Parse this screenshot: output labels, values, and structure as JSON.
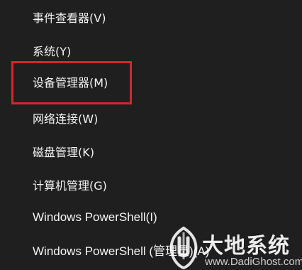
{
  "menu": {
    "items": [
      {
        "label": "事件查看器(V)"
      },
      {
        "label": "系统(Y)"
      },
      {
        "label": "设备管理器(M)"
      },
      {
        "label": "网络连接(W)"
      },
      {
        "label": "磁盘管理(K)"
      },
      {
        "label": "计算机管理(G)"
      },
      {
        "label": "Windows PowerShell(I)"
      },
      {
        "label": "Windows PowerShell (管理员)(A)"
      }
    ]
  },
  "watermark": {
    "title": "大地系统",
    "subtitle": "www.DadiGhost.com"
  },
  "colors": {
    "background": "#1f1f1f",
    "text": "#f3f3f3",
    "highlight": "#d7262d"
  },
  "icons": {
    "watermark_logo": "dadi-logo-icon"
  }
}
